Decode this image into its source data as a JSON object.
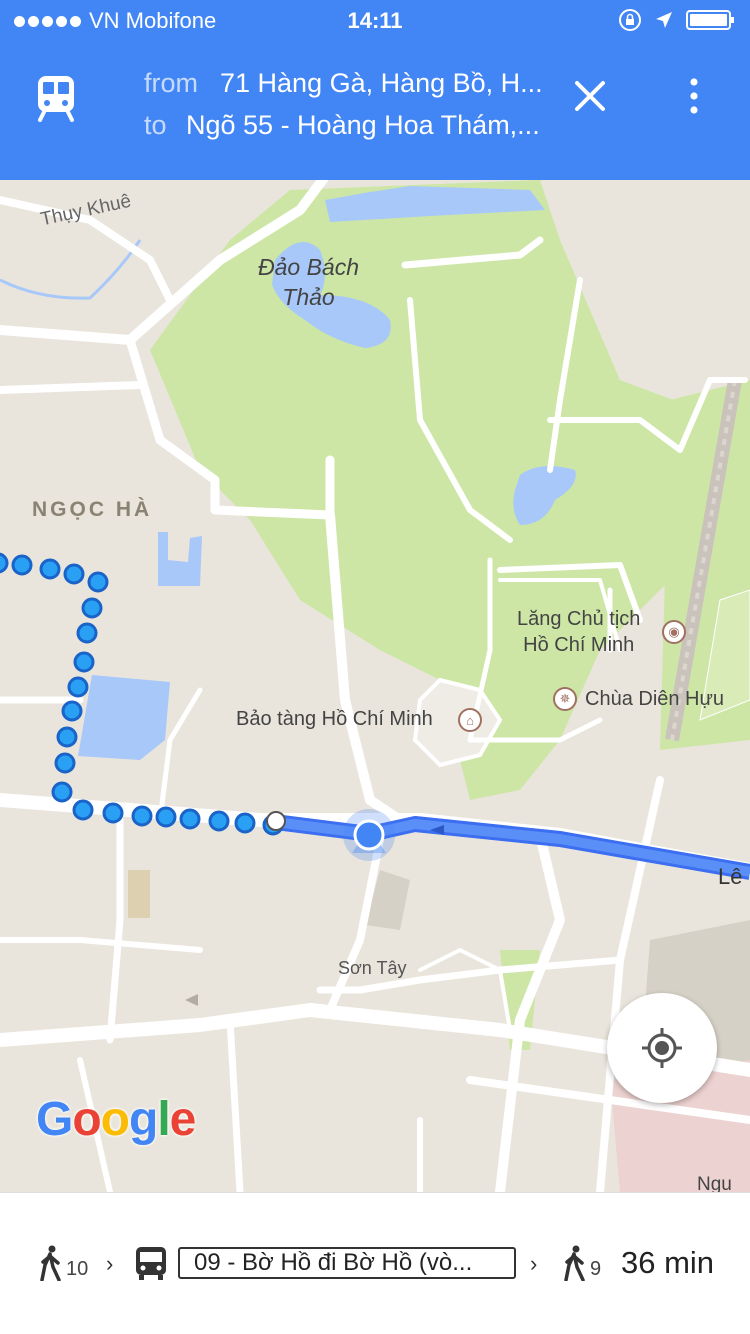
{
  "status_bar": {
    "carrier": "VN Mobifone",
    "time": "14:11"
  },
  "header": {
    "from_label": "from",
    "from_value": "71 Hàng Gà, Hàng Bồ, H...",
    "to_label": "to",
    "to_value": "Ngõ 55 - Hoàng Hoa Thám,...",
    "mode_icon": "train-icon"
  },
  "map": {
    "labels": {
      "thuy_khue": "Thụy Khuê",
      "dao_bach_thao_1": "Đảo Bách",
      "dao_bach_thao_2": "Thảo",
      "ngoc_ha": "NGỌC HÀ",
      "lang_1": "Lăng Chủ tịch",
      "lang_2": "Hồ Chí Minh",
      "chua": "Chùa Diên Hựu",
      "bao_tang": "Bảo tàng Hồ Chí Minh",
      "son_tay": "Sơn Tây",
      "le": "Lê",
      "ngu": "Ngu"
    },
    "colors": {
      "land": "#e9e5dc",
      "park": "#cde6a6",
      "water": "#a7c8f9",
      "route": "#4d7ff0",
      "walk_dot": "#2a9df4"
    },
    "logo": {
      "G": "G",
      "o1": "o",
      "o2": "o",
      "g": "g",
      "l": "l",
      "e": "e"
    }
  },
  "bottom": {
    "walk_start_minutes": "10",
    "bus_route": "09 - Bờ Hồ đi Bờ Hồ (vò...",
    "walk_end_minutes": "9",
    "duration": "36 min",
    "chevron": "›"
  }
}
